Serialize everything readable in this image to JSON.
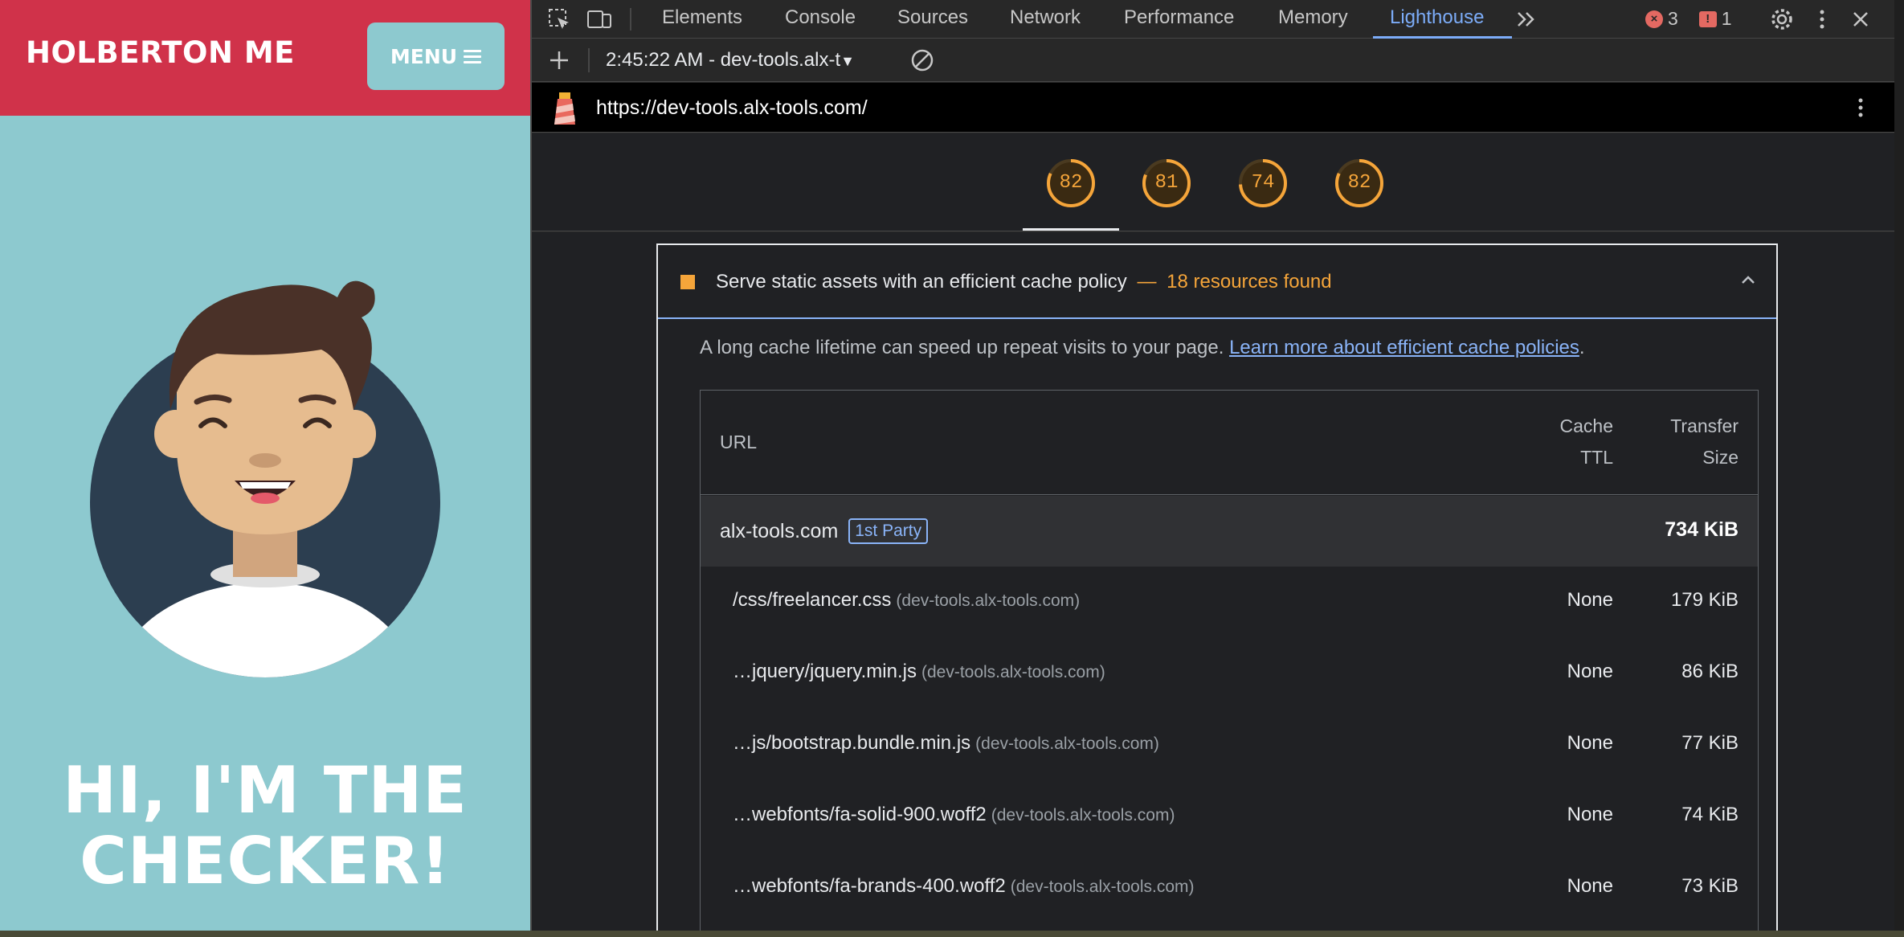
{
  "site": {
    "brand": "HOLBERTON ME",
    "menu_label": "MENU",
    "hero_line1": "HI, I'M THE",
    "hero_line2": "CHECKER!"
  },
  "devtools": {
    "tabs": [
      {
        "label": "Elements",
        "active": false
      },
      {
        "label": "Console",
        "active": false
      },
      {
        "label": "Sources",
        "active": false
      },
      {
        "label": "Network",
        "active": false
      },
      {
        "label": "Performance",
        "active": false
      },
      {
        "label": "Memory",
        "active": false
      },
      {
        "label": "Lighthouse",
        "active": true
      }
    ],
    "error_count": "3",
    "issue_count": "1",
    "report_selector": "2:45:22 AM - dev-tools.alx-t",
    "report_url": "https://dev-tools.alx-tools.com/",
    "scores": [
      "82",
      "81",
      "74",
      "82"
    ],
    "score_values": [
      82,
      81,
      74,
      82
    ],
    "accent_color": "#7cacf8",
    "score_color": "#f5a53a"
  },
  "audit": {
    "title": "Serve static assets with an efficient cache policy",
    "separator": "—",
    "count_text": "18 resources found",
    "description": "A long cache lifetime can speed up repeat visits to your page.",
    "link_text": "Learn more about efficient cache policies",
    "period": ".",
    "columns": {
      "url": "URL",
      "cache_ttl_1": "Cache",
      "cache_ttl_2": "TTL",
      "transfer_1": "Transfer",
      "transfer_2": "Size"
    },
    "group": {
      "name": "alx-tools.com",
      "badge": "1st Party",
      "size": "734 KiB"
    },
    "rows": [
      {
        "url": "/css/freelancer.css",
        "host": "(dev-tools.alx-tools.com)",
        "ttl": "None",
        "size": "179 KiB"
      },
      {
        "url": "…jquery/jquery.min.js",
        "host": "(dev-tools.alx-tools.com)",
        "ttl": "None",
        "size": "86 KiB"
      },
      {
        "url": "…js/bootstrap.bundle.min.js",
        "host": "(dev-tools.alx-tools.com)",
        "ttl": "None",
        "size": "77 KiB"
      },
      {
        "url": "…webfonts/fa-solid-900.woff2",
        "host": "(dev-tools.alx-tools.com)",
        "ttl": "None",
        "size": "74 KiB"
      },
      {
        "url": "…webfonts/fa-brands-400.woff2",
        "host": "(dev-tools.alx-tools.com)",
        "ttl": "None",
        "size": "73 KiB"
      }
    ]
  }
}
